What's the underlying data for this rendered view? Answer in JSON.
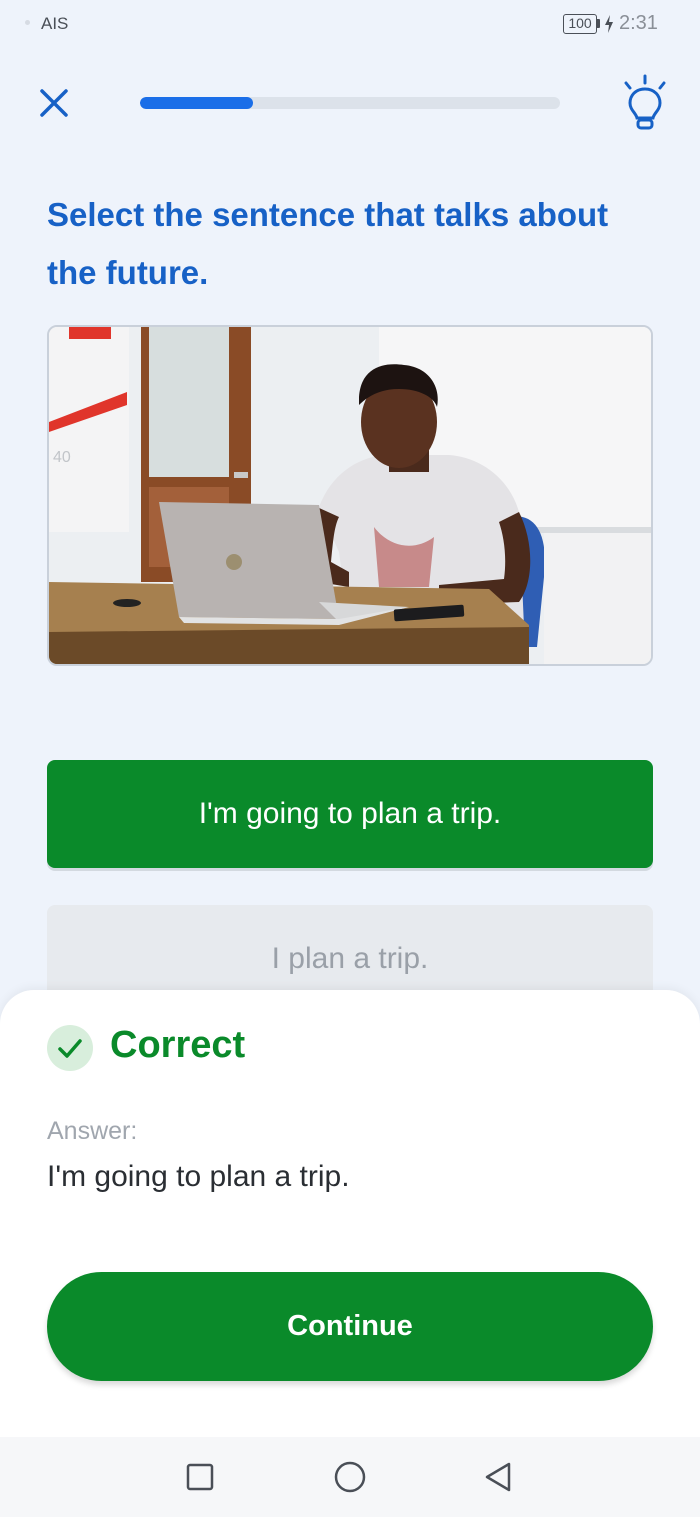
{
  "status_bar": {
    "carrier": "AIS",
    "battery": "100",
    "time": "2:31"
  },
  "top_bar": {
    "close_icon": "close-icon",
    "hint_icon": "lightbulb-icon",
    "progress_fraction": 0.27,
    "progress_color": "#1a6ee8"
  },
  "question": {
    "text": "Select the sentence that talks about the future."
  },
  "image": {
    "icon": "photo-man-using-laptop"
  },
  "options": [
    {
      "label": "I'm going to plan a trip.",
      "state": "correct"
    },
    {
      "label": "I plan a trip.",
      "state": "unselected"
    }
  ],
  "feedback": {
    "status_icon": "check-icon",
    "title": "Correct",
    "answer_label": "Answer:",
    "answer_text": "I'm going to plan a trip.",
    "continue_label": "Continue",
    "success_color": "#0a8a2a"
  },
  "nav_bar": {
    "recents_icon": "square-icon",
    "home_icon": "circle-icon",
    "back_icon": "triangle-back-icon"
  }
}
